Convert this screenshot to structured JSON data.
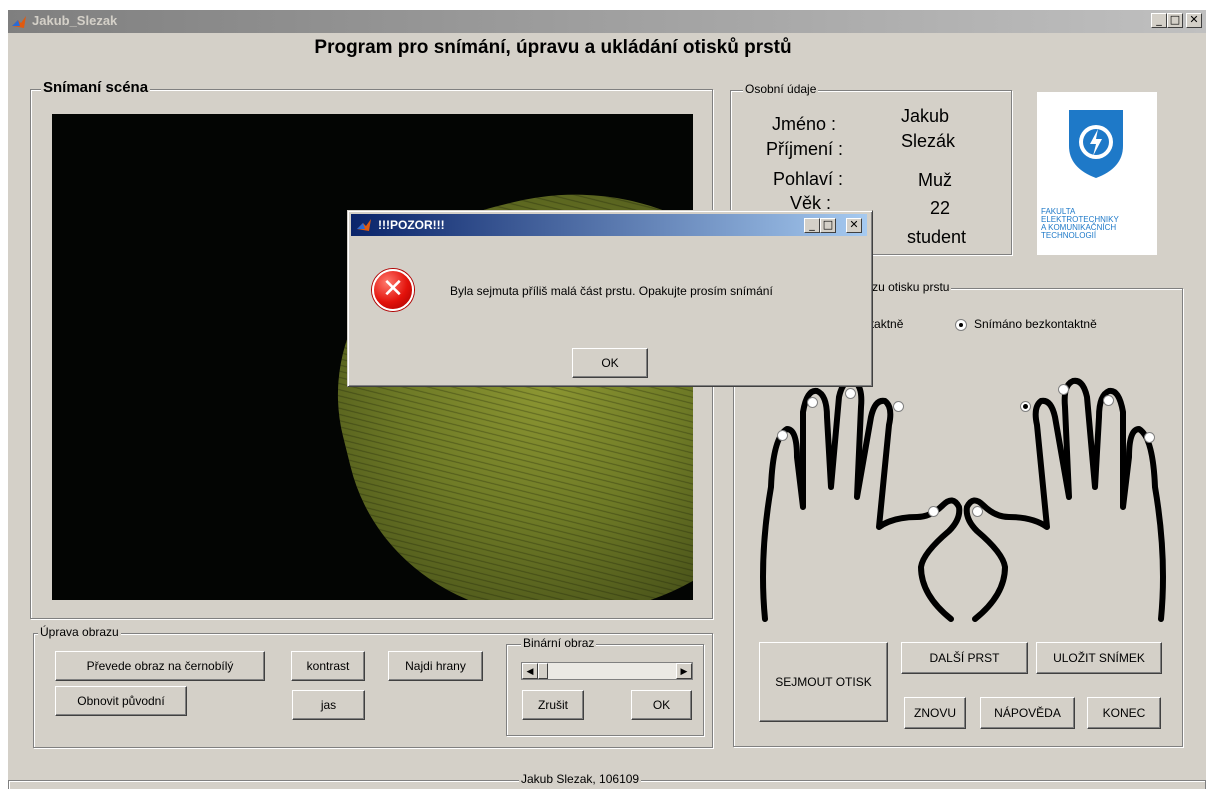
{
  "window": {
    "title": "Jakub_Slezak",
    "minimize": "_",
    "maximize": "□",
    "close": "✕"
  },
  "heading": "Program pro snímání, úpravu a ukládání otisků prstů",
  "scene": {
    "label": "Snímaní scéna"
  },
  "personal": {
    "label": "Osobní údaje",
    "jmeno_label": "Jméno :",
    "jmeno_value": "Jakub",
    "prijmeni_label": "Příjmení :",
    "prijmeni_value": "Slezák",
    "pohlavi_label": "Pohlaví :",
    "pohlavi_value": "Muž",
    "vek_label": "Věk :",
    "vek_value": "22",
    "povolani_value": "student"
  },
  "logo": {
    "text_lines": [
      "FAKULTA",
      "ELEKTROTECHNIKY",
      "A KOMUNIKAČNÍCH",
      "TECHNOLOGIÍ"
    ]
  },
  "capture": {
    "label": "Snímání a uložení obrazu otisku prstu",
    "radio_contact": "Snímáno kontaktně",
    "radio_contactless": "Snímáno bezkontaktně",
    "selected_finger": "right-index"
  },
  "edit": {
    "label": "Úprava obrazu",
    "grayscale": "Převede obraz na černobílý",
    "restore": "Obnovit původní",
    "contrast": "kontrast",
    "brightness": "jas",
    "edges": "Najdi hrany"
  },
  "binary": {
    "label": "Binární obraz",
    "cancel": "Zrušit",
    "ok": "OK",
    "slider_value": 0
  },
  "actions": {
    "capture": "SEJMOUT OTISK",
    "next": "DALŠÍ PRST",
    "save": "ULOŽIT SNÍMEK",
    "again": "ZNOVU",
    "help": "NÁPOVĚDA",
    "end": "KONEC"
  },
  "footer": {
    "author": "Jakub Slezak, 106109"
  },
  "dialog": {
    "title": "!!!POZOR!!!",
    "message": "Byla sejmuta příliš malá část prstu. Opakujte prosím snímání",
    "ok": "OK"
  }
}
